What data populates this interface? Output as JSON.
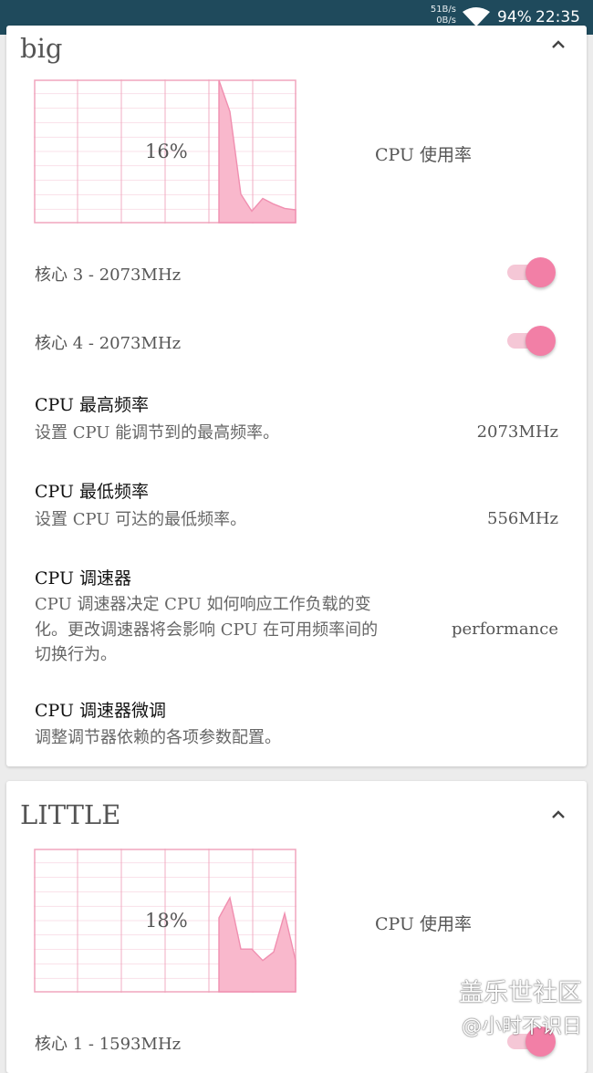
{
  "status_bar": {
    "net_up": "51B/s",
    "net_down": "0B/s",
    "battery": "94%",
    "time": "22:35",
    "wifi_icon": "wifi-icon"
  },
  "colors": {
    "accent_pink": "#f27fa6",
    "graph_fill": "#f9b8cc",
    "graph_grid": "#f0a5bd",
    "status_bar_bg": "#1f4a5c"
  },
  "big_cluster": {
    "title": "big",
    "usage_percent": "16%",
    "usage_label": "CPU 使用率",
    "usage_history": [
      100,
      78,
      20,
      8,
      17,
      13,
      10,
      9
    ],
    "cores": [
      {
        "label": "核心 3 - 2073MHz",
        "enabled": true
      },
      {
        "label": "核心 4 - 2073MHz",
        "enabled": true
      }
    ],
    "max_freq": {
      "title": "CPU 最高频率",
      "summary": "设置 CPU 能调节到的最高频率。",
      "value": "2073MHz"
    },
    "min_freq": {
      "title": "CPU 最低频率",
      "summary": "设置 CPU 可达的最低频率。",
      "value": "556MHz"
    },
    "governor": {
      "title": "CPU 调速器",
      "summary_line1": "CPU 调速器决定 CPU 如何响应工作负载的变",
      "summary_line2": "化。更改调速器将会影响 CPU 在可用频率间的",
      "summary_line3": "切换行为。",
      "value": "performance"
    },
    "governor_tunables": {
      "title": "CPU 调速器微调",
      "summary": "调整调节器依赖的各项参数配置。"
    }
  },
  "little_cluster": {
    "title": "LITTLE",
    "usage_percent": "18%",
    "usage_label": "CPU 使用率",
    "usage_history": [
      52,
      66,
      30,
      30,
      22,
      28,
      55,
      22
    ],
    "cores": [
      {
        "label": "核心 1 - 1593MHz",
        "enabled": true
      }
    ]
  },
  "watermark": {
    "line1": "盖乐世社区",
    "line2": "@小时不识日"
  }
}
